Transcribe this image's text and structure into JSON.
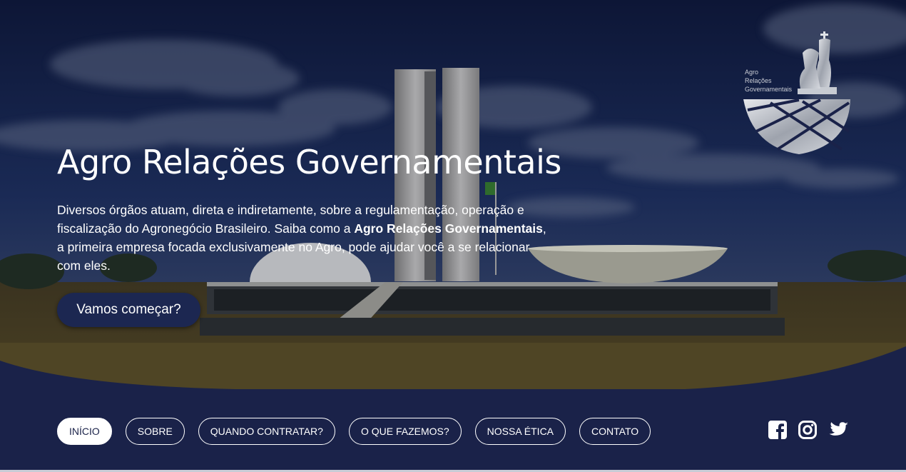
{
  "hero": {
    "title": "Agro Relações Governamentais",
    "description_before": "Diversos órgãos atuam, direta e indiretamente, sobre a regulamentação, operação e fiscalização do Agronegócio Brasileiro. Saiba como a ",
    "description_bold": "Agro Relações Governamentais",
    "description_after": ", a primeira empresa focada exclusivamente no Agro, pode ajudar você a se relacionar com eles.",
    "cta_label": "Vamos começar?"
  },
  "logo": {
    "line1": "Agro",
    "line2": "Relações",
    "line3": "Governamentais"
  },
  "nav": {
    "items": [
      {
        "label": "INÍCIO",
        "active": true
      },
      {
        "label": "SOBRE"
      },
      {
        "label": "QUANDO CONTRATAR?"
      },
      {
        "label": "O QUE FAZEMOS?"
      },
      {
        "label": "NOSSA ÉTICA"
      },
      {
        "label": "CONTATO"
      }
    ]
  },
  "social": [
    "facebook-icon",
    "instagram-icon",
    "twitter-icon"
  ],
  "colors": {
    "navy": "#1a2249",
    "button": "#1c2751",
    "white": "#ffffff"
  }
}
